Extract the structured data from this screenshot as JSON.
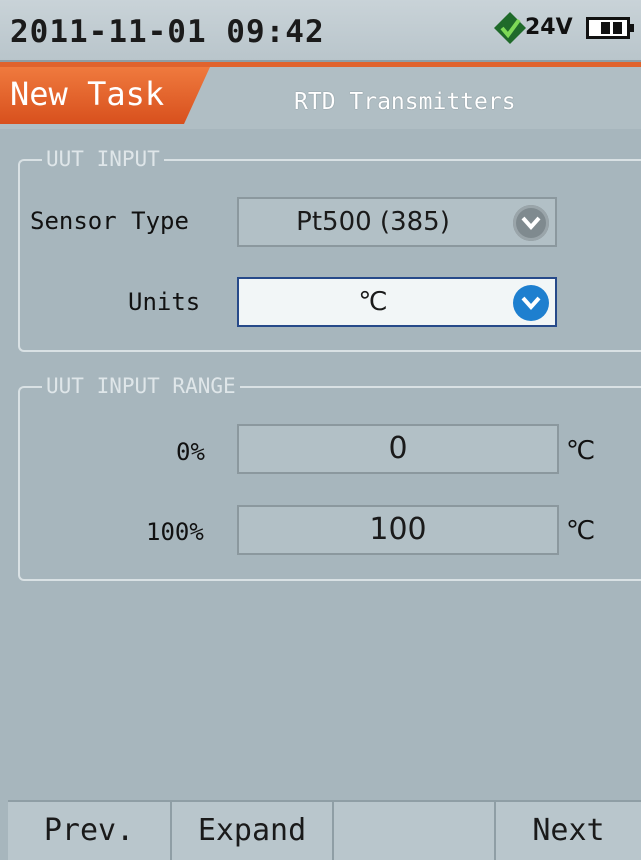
{
  "status": {
    "datetime": "2011-11-01 09:42",
    "voltage": "24V",
    "power_icon": "power-plug-icon",
    "battery_level": 0.66
  },
  "header": {
    "active_tab": "New Task",
    "title": "RTD Transmitters"
  },
  "uut_input": {
    "title": "UUT INPUT",
    "sensor_type": {
      "label": "Sensor Type",
      "value": "Pt500 (385)"
    },
    "units": {
      "label": "Units",
      "value": "℃"
    }
  },
  "uut_input_range": {
    "title": "UUT INPUT RANGE",
    "rows": [
      {
        "label": "0%",
        "value": "0",
        "unit": "℃"
      },
      {
        "label": "100%",
        "value": "100",
        "unit": "℃"
      }
    ]
  },
  "softkeys": [
    "Prev.",
    "Expand",
    "",
    "Next"
  ],
  "colors": {
    "accent": "#e0632d",
    "background": "#a7b6bd",
    "active_field_border": "#274a8a",
    "dropdown_active": "#1e7fcf"
  }
}
